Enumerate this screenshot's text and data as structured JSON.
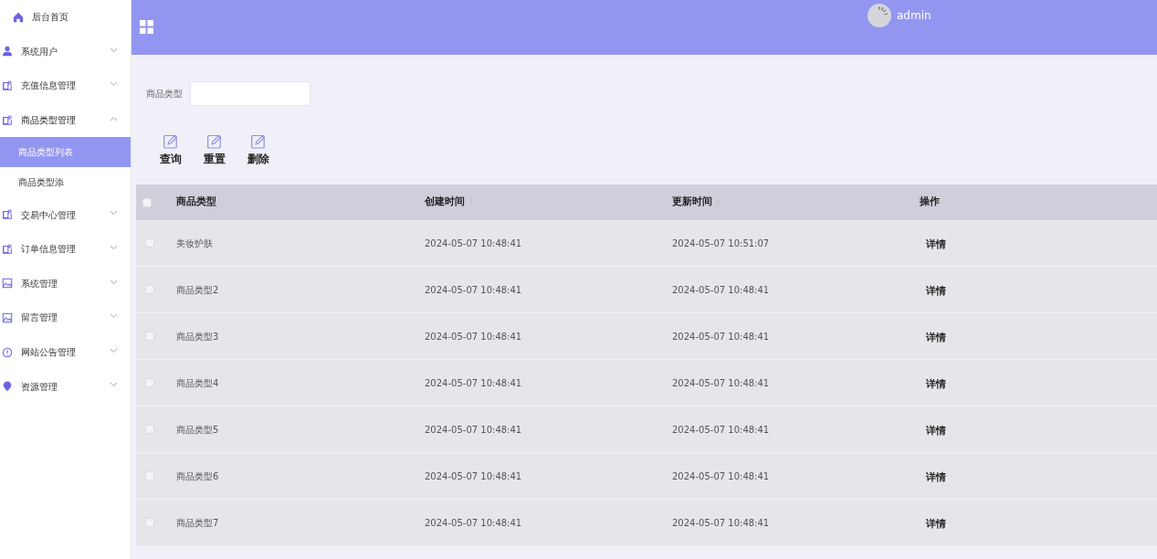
{
  "sidebar": {
    "items": [
      {
        "label": "后台首页",
        "kind": "home"
      },
      {
        "label": "系统用户",
        "kind": "user",
        "expanded": false
      },
      {
        "label": "充值信息管理",
        "kind": "tag",
        "expanded": false
      },
      {
        "label": "商品类型管理",
        "kind": "tag",
        "expanded": true,
        "children": [
          {
            "label": "商品类型列表",
            "selected": true
          },
          {
            "label": "商品类型添",
            "selected": false
          }
        ]
      },
      {
        "label": "交易中心管理",
        "kind": "tag",
        "expanded": false
      },
      {
        "label": "订单信息管理",
        "kind": "tag",
        "expanded": false
      },
      {
        "label": "系统管理",
        "kind": "image",
        "expanded": false
      },
      {
        "label": "留言管理",
        "kind": "image",
        "expanded": false
      },
      {
        "label": "网站公告管理",
        "kind": "info",
        "expanded": false
      },
      {
        "label": "资源管理",
        "kind": "pin",
        "expanded": false
      }
    ]
  },
  "header": {
    "user": "admin"
  },
  "search": {
    "label": "商品类型"
  },
  "actions": [
    "查询",
    "重置",
    "删除"
  ],
  "table": {
    "all_checked": false,
    "columns": [
      {
        "label": "商品类型",
        "sortable": false
      },
      {
        "label": "创建时间",
        "sortable": true
      },
      {
        "label": "更新时间",
        "sortable": true
      },
      {
        "label": "操作",
        "sortable": false
      }
    ],
    "rows": [
      {
        "checked": false,
        "cells": [
          "美妆护肤",
          "2024-05-07 10:48:41",
          "2024-05-07 10:51:07"
        ],
        "action": "详情"
      },
      {
        "checked": false,
        "cells": [
          "商品类型2",
          "2024-05-07 10:48:41",
          "2024-05-07 10:48:41"
        ],
        "action": "详情"
      },
      {
        "checked": false,
        "cells": [
          "商品类型3",
          "2024-05-07 10:48:41",
          "2024-05-07 10:48:41"
        ],
        "action": "详情"
      },
      {
        "checked": false,
        "cells": [
          "商品类型4",
          "2024-05-07 10:48:41",
          "2024-05-07 10:48:41"
        ],
        "action": "详情"
      },
      {
        "checked": false,
        "cells": [
          "商品类型5",
          "2024-05-07 10:48:41",
          "2024-05-07 10:48:41"
        ],
        "action": "详情"
      },
      {
        "checked": false,
        "cells": [
          "商品类型6",
          "2024-05-07 10:48:41",
          "2024-05-07 10:48:41"
        ],
        "action": "详情"
      },
      {
        "checked": false,
        "cells": [
          "商品类型7",
          "2024-05-07 10:48:41",
          "2024-05-07 10:48:41"
        ],
        "action": "详情"
      }
    ]
  }
}
